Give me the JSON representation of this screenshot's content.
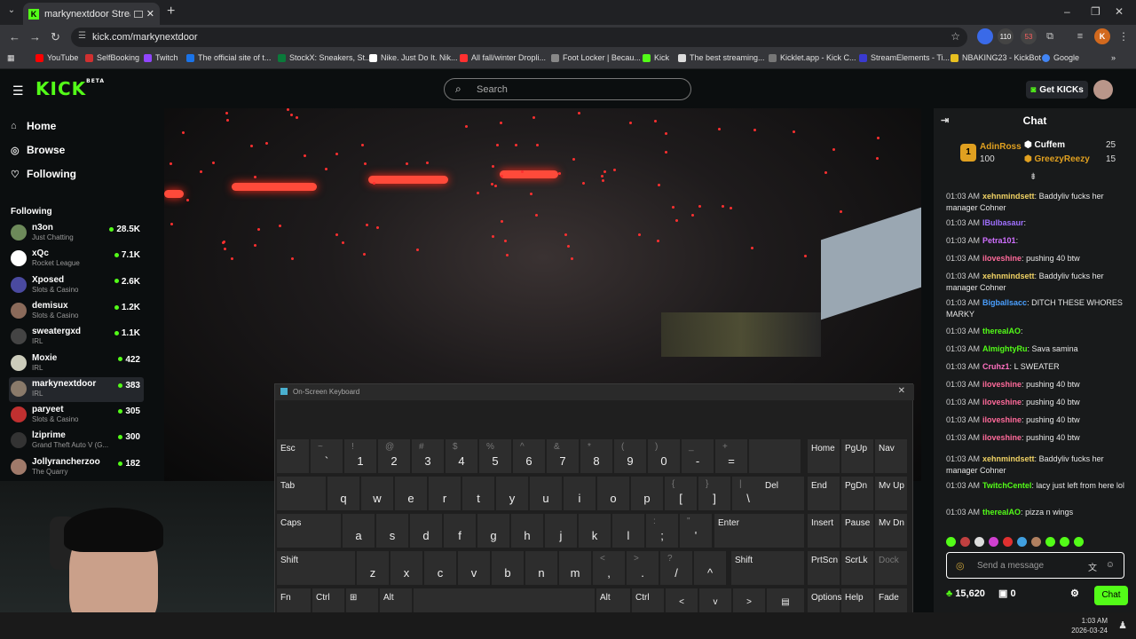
{
  "browser": {
    "tab_title": "markynextdoor Stream - W",
    "url": "kick.com/markynextdoor",
    "ext_badges": [
      "110",
      "53"
    ],
    "profile_initial": "K",
    "bookmarks": [
      "YouTube",
      "SelfBooking",
      "Twitch",
      "The official site of t...",
      "StockX: Sneakers, St...",
      "Nike. Just Do It. Nik...",
      "All fall/winter Dropli...",
      "Foot Locker | Becau...",
      "Kick",
      "The best streaming...",
      "Kicklet.app - Kick C...",
      "StreamElements - Ti...",
      "NBAKING23 - KickBot",
      "Google"
    ]
  },
  "header": {
    "logo": "KICK",
    "logo_sup": "BETA",
    "search_placeholder": "Search",
    "get_kicks": "Get KICKs"
  },
  "sidebar": {
    "nav": [
      {
        "label": "Home",
        "icon": "home-icon"
      },
      {
        "label": "Browse",
        "icon": "browse-icon"
      },
      {
        "label": "Following",
        "icon": "heart-icon"
      }
    ],
    "following_title": "Following",
    "following": [
      {
        "name": "n3on",
        "category": "Just Chatting",
        "viewers": "28.5K",
        "color": "#6d8a5a"
      },
      {
        "name": "xQc",
        "category": "Rocket League",
        "viewers": "7.1K",
        "color": "#ffffff"
      },
      {
        "name": "Xposed",
        "category": "Slots & Casino",
        "viewers": "2.6K",
        "color": "#4a4aa0"
      },
      {
        "name": "demisux",
        "category": "Slots & Casino",
        "viewers": "1.2K",
        "color": "#8a6a5a"
      },
      {
        "name": "sweatergxd",
        "category": "IRL",
        "viewers": "1.1K",
        "color": "#444"
      },
      {
        "name": "Moxie",
        "category": "IRL",
        "viewers": "422",
        "color": "#ccb"
      },
      {
        "name": "markynextdoor",
        "category": "IRL",
        "viewers": "383",
        "color": "#8a7a6a"
      },
      {
        "name": "paryeet",
        "category": "Slots & Casino",
        "viewers": "305",
        "color": "#c03030"
      },
      {
        "name": "lziprime",
        "category": "Grand Theft Auto V (G...",
        "viewers": "300",
        "color": "#333"
      },
      {
        "name": "Jollyrancherzoo",
        "category": "The Quarry",
        "viewers": "182",
        "color": "#a07a6a"
      }
    ]
  },
  "osk": {
    "title": "On-Screen Keyboard",
    "row1": [
      [
        "Esc",
        ""
      ],
      [
        "`",
        "~"
      ],
      [
        "1",
        "!"
      ],
      [
        "2",
        "@"
      ],
      [
        "3",
        "#"
      ],
      [
        "4",
        "$"
      ],
      [
        "5",
        "%"
      ],
      [
        "6",
        "^"
      ],
      [
        "7",
        "&"
      ],
      [
        "8",
        "*"
      ],
      [
        "9",
        "("
      ],
      [
        "0",
        ")"
      ],
      [
        "-",
        "_"
      ],
      [
        "=",
        "+"
      ],
      [
        "",
        ""
      ]
    ],
    "row2": [
      [
        "Tab",
        ""
      ],
      [
        "q",
        ""
      ],
      [
        "w",
        ""
      ],
      [
        "e",
        ""
      ],
      [
        "r",
        ""
      ],
      [
        "t",
        ""
      ],
      [
        "y",
        ""
      ],
      [
        "u",
        ""
      ],
      [
        "i",
        ""
      ],
      [
        "o",
        ""
      ],
      [
        "p",
        ""
      ],
      [
        "[",
        "{"
      ],
      [
        "]",
        "}"
      ],
      [
        "\\",
        "|"
      ],
      [
        "Del",
        ""
      ]
    ],
    "row3": [
      [
        "Caps",
        ""
      ],
      [
        "a",
        ""
      ],
      [
        "s",
        ""
      ],
      [
        "d",
        ""
      ],
      [
        "f",
        ""
      ],
      [
        "g",
        ""
      ],
      [
        "h",
        ""
      ],
      [
        "j",
        ""
      ],
      [
        "k",
        ""
      ],
      [
        "l",
        ""
      ],
      [
        ";",
        ":"
      ],
      [
        "'",
        "\""
      ],
      [
        "Enter",
        ""
      ]
    ],
    "row4": [
      [
        "Shift",
        ""
      ],
      [
        "z",
        ""
      ],
      [
        "x",
        ""
      ],
      [
        "c",
        ""
      ],
      [
        "v",
        ""
      ],
      [
        "b",
        ""
      ],
      [
        "n",
        ""
      ],
      [
        "m",
        ""
      ],
      [
        ",",
        "<"
      ],
      [
        ".",
        ">"
      ],
      [
        "/",
        "?"
      ],
      [
        "^",
        ""
      ],
      [
        "Shift",
        ""
      ]
    ],
    "row5": [
      "Fn",
      "Ctrl",
      "⊞",
      "Alt",
      "",
      "Alt",
      "Ctrl",
      "<",
      "v",
      ">",
      "▤"
    ],
    "nav_keys": [
      [
        "Home",
        "PgUp",
        "Nav"
      ],
      [
        "End",
        "PgDn",
        "Mv Up"
      ],
      [
        "Insert",
        "Pause",
        "Mv Dn"
      ],
      [
        "PrtScn",
        "ScrLk",
        "Dock"
      ],
      [
        "Options",
        "Help",
        "Fade"
      ]
    ]
  },
  "chat": {
    "title": "Chat",
    "leaderboard": {
      "rank": "1",
      "first_name": "AdinRoss",
      "first_count": "100",
      "second_name": "Cuffem",
      "second_count": "25",
      "third_name": "GreezyReezy",
      "third_count": "15"
    },
    "messages": [
      {
        "time": "01:03 AM",
        "user": "xehnmindsett",
        "color": "#f0d264",
        "text": "Baddyliv fucks her manager Cohner"
      },
      {
        "time": "01:03 AM",
        "user": "lBulbasaur",
        "color": "#a070ff",
        "text": ""
      },
      {
        "time": "01:03 AM",
        "user": "Petra101",
        "color": "#d070ff",
        "text": ""
      },
      {
        "time": "01:03 AM",
        "user": "iloveshine",
        "color": "#ff6a9a",
        "text": "pushing 40 btw"
      },
      {
        "time": "01:03 AM",
        "user": "xehnmindsett",
        "color": "#f0d264",
        "text": "Baddyliv fucks her manager Cohner"
      },
      {
        "time": "01:03 AM",
        "user": "Bigballsacc",
        "color": "#4aa0ff",
        "text": "DITCH THESE WHORES MARKY"
      },
      {
        "time": "01:03 AM",
        "user": "therealAO",
        "color": "#53fc18",
        "text": ""
      },
      {
        "time": "01:03 AM",
        "user": "AlmightyRu",
        "color": "#53fc18",
        "text": "Sava samina"
      },
      {
        "time": "01:03 AM",
        "user": "Cruhz1",
        "color": "#ff70c0",
        "text": "L SWEATER"
      },
      {
        "time": "01:03 AM",
        "user": "iloveshine",
        "color": "#ff6a9a",
        "text": "pushing 40 btw"
      },
      {
        "time": "01:03 AM",
        "user": "iloveshine",
        "color": "#ff6a9a",
        "text": "pushing 40 btw"
      },
      {
        "time": "01:03 AM",
        "user": "iloveshine",
        "color": "#ff6a9a",
        "text": "pushing 40 btw"
      },
      {
        "time": "01:03 AM",
        "user": "iloveshine",
        "color": "#ff6a9a",
        "text": "pushing 40 btw"
      },
      {
        "time": "01:03 AM",
        "user": "xehnmindsett",
        "color": "#f0d264",
        "text": "Baddyliv fucks her manager Cohner"
      },
      {
        "time": "01:03 AM",
        "user": "TwitchCentel",
        "color": "#53fc18",
        "text": "lacy just left from here lol"
      },
      {
        "time": "01:03 AM",
        "user": "therealAO",
        "color": "#53fc18",
        "text": "pizza n wings"
      }
    ],
    "input_placeholder": "Send a message",
    "kicks_balance": "15,620",
    "gift_count": "0",
    "chat_button": "Chat"
  },
  "taskbar": {
    "time": "1:03 AM",
    "date": "2026-03-24"
  }
}
